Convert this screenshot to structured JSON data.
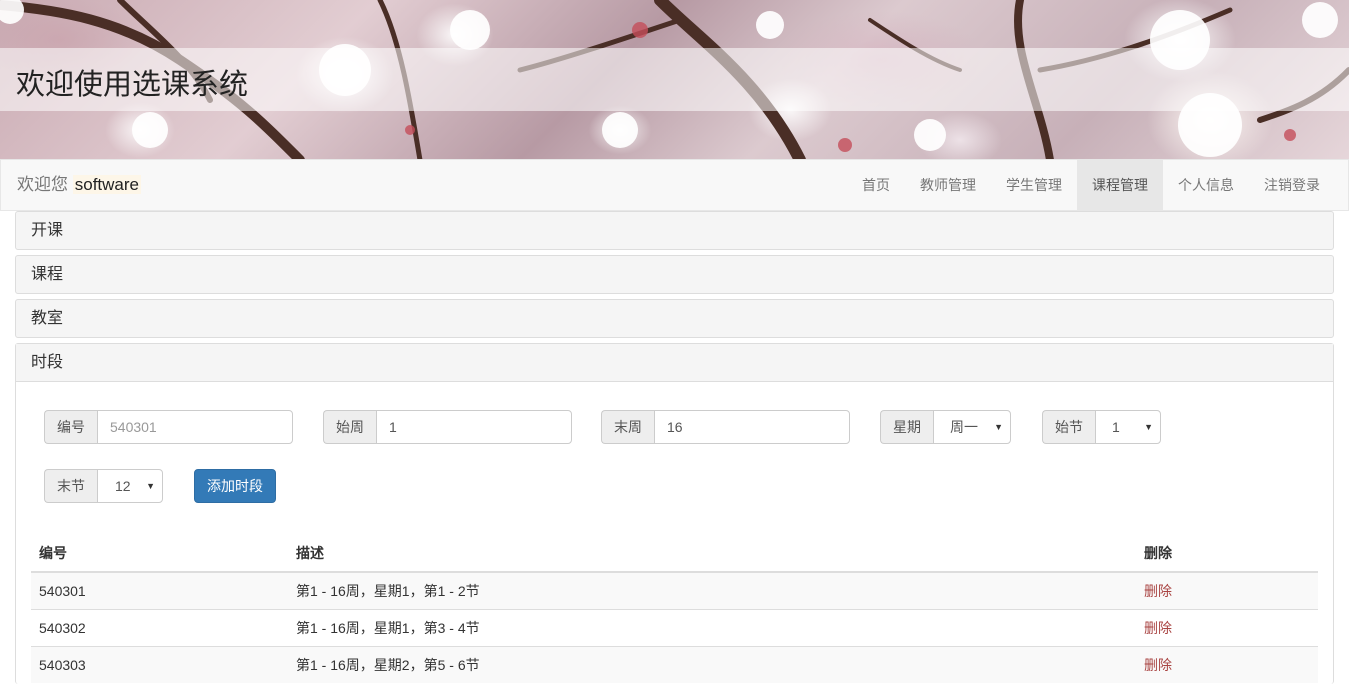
{
  "banner": {
    "title": "欢迎使用选课系统"
  },
  "navbar": {
    "welcome_prefix": "欢迎您",
    "username": "software",
    "items": [
      {
        "label": "首页"
      },
      {
        "label": "教师管理"
      },
      {
        "label": "学生管理"
      },
      {
        "label": "课程管理",
        "active": true
      },
      {
        "label": "个人信息"
      },
      {
        "label": "注销登录"
      }
    ]
  },
  "panels": [
    {
      "title": "开课"
    },
    {
      "title": "课程"
    },
    {
      "title": "教室"
    },
    {
      "title": "时段"
    }
  ],
  "form": {
    "id_label": "编号",
    "id_placeholder": "540301",
    "start_week_label": "始周",
    "start_week_value": "1",
    "end_week_label": "末周",
    "end_week_value": "16",
    "weekday_label": "星期",
    "weekday_value": "周一",
    "start_period_label": "始节",
    "start_period_value": "1",
    "end_period_label": "末节",
    "end_period_value": "12",
    "submit_label": "添加时段"
  },
  "table": {
    "headers": {
      "id": "编号",
      "desc": "描述",
      "delete": "删除"
    },
    "rows": [
      {
        "id": "540301",
        "desc": "第1 - 16周，星期1，第1 - 2节",
        "action": "删除"
      },
      {
        "id": "540302",
        "desc": "第1 - 16周，星期1，第3 - 4节",
        "action": "删除"
      },
      {
        "id": "540303",
        "desc": "第1 - 16周，星期2，第5 - 6节",
        "action": "删除"
      }
    ]
  },
  "colors": {
    "primary": "#337ab7",
    "danger_link": "#a94442",
    "navbar_bg": "#f8f8f8"
  }
}
